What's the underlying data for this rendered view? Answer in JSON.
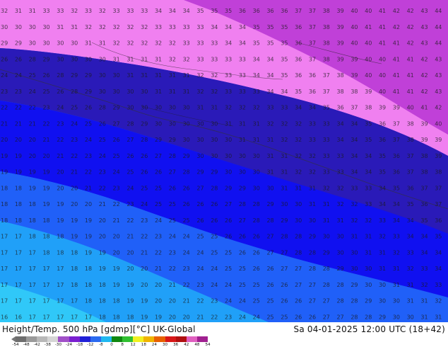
{
  "footer": {
    "title": "Height/Temp. 500 hPa [gdmp][°C] UK-Global",
    "valid_time": "Sa 04-01-2025 12:00 UTC (18+42)"
  },
  "scale": {
    "ticks": [
      "-54",
      "-48",
      "-42",
      "-38",
      "-30",
      "-24",
      "-18",
      "-12",
      "-8",
      "0",
      "8",
      "12",
      "18",
      "24",
      "30",
      "36",
      "42",
      "48",
      "54"
    ],
    "colors": [
      "#6e6e6e",
      "#9a9a9a",
      "#b8b8b8",
      "#d5d5d5",
      "#a050c8",
      "#7a1fd0",
      "#2020d8",
      "#2a6af0",
      "#20b8f0",
      "#108810",
      "#30c030",
      "#f0f020",
      "#f0b400",
      "#e86000",
      "#d81818",
      "#b01010",
      "#e060c0",
      "#a02090"
    ]
  },
  "map": {
    "temperature_bands": [
      {
        "band": "-34 to -44",
        "color": "#c040d8"
      },
      {
        "band": "-30 to -33",
        "color": "#f080f0"
      },
      {
        "band": "-26 to -29",
        "color": "#2a1ab8"
      },
      {
        "band": "-22 to -25",
        "color": "#1010f0"
      },
      {
        "band": "-20 to -21",
        "color": "#2060f8"
      },
      {
        "band": "-18 to -19",
        "color": "#20a0f8"
      },
      {
        "band": "-16 to -17",
        "color": "#30c8f8"
      }
    ],
    "label_rows": [
      "3231313333323332333333343434353535363636363737383940404142424344",
      "3030303031313232323232333333333434343535353637383940414142424344",
      "2929303030303131323232323233333334343535353637383940404141424344",
      "2626282930303030313131313232333333333434353637383939404041414243",
      "2424252628292930303131313131323233333434353636373839404041414243",
      "2323242526282930303030313131323233333334343536373838394041414243",
      "2222222324252628293030303030313132323233333434353637383939404142",
      "2121212223242526272829303030303031313132323233333434353637383940",
      "2020202122232425262728292930303030313131323233333434353637383939",
      "1919202021222324252626272829303030303031313232333334343536373839",
      "1919191920212223242526262728292930303031313232333334343536373838",
      "1818191920202122232425252626272829293030313131323233333435363737",
      "1818181919202021222324252526262627282829303031313232333434353637",
      "1818181819191920212223242525262626272828293030313132323334343536",
      "1717181818191920202122232424252526262627282829303031313233343435",
      "1717171818181919202021222324242525262627272828293030313132333434",
      "1717171717181819192020212223242425252626272728282930303131323334",
      "1717171717181818191920202122232424252526262727282829303031313233",
      "1717171717171818181919202021222324242525262627272828293030313132",
      "1616171717171718181819192020212223242425252626272728282930303131"
    ],
    "sea_labels": [
      "5",
      "6",
      "5",
      "7"
    ]
  }
}
